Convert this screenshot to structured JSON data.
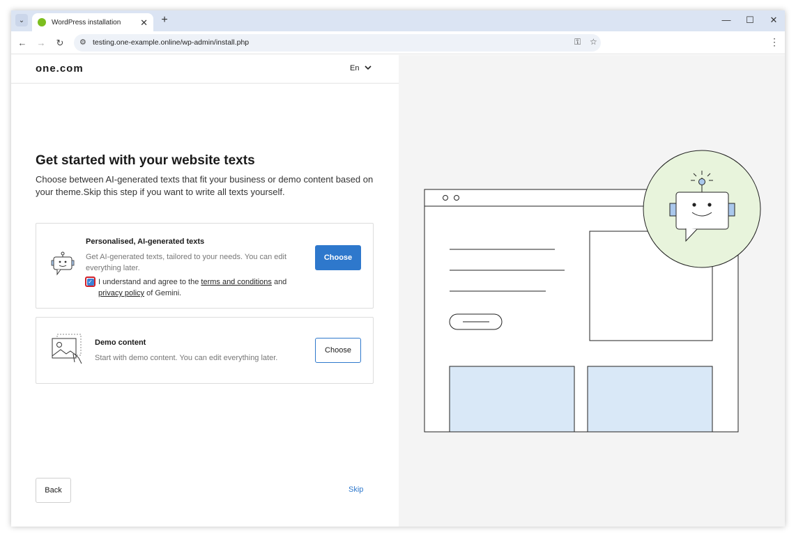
{
  "browser": {
    "tab_title": "WordPress installation",
    "url": "testing.one-example.online/wp-admin/install.php",
    "new_tab": "+",
    "tab_close": "✕",
    "minimize": "—",
    "maximize": "☐",
    "close": "✕"
  },
  "header": {
    "logo": "one.com",
    "language": "En"
  },
  "main": {
    "heading": "Get started with your website texts",
    "subtext": "Choose between AI-generated texts that fit your business or demo content based on your theme.Skip this step if you want to write all texts yourself."
  },
  "option_ai": {
    "title": "Personalised, AI-generated texts",
    "description": "Get AI-generated texts, tailored to your needs. You can edit everything later.",
    "agree_prefix": "I understand and agree to the ",
    "terms_link": "terms and conditions",
    "agree_middle": " and ",
    "privacy_link": "privacy policy",
    "agree_suffix": " of Gemini.",
    "checked": true,
    "button": "Choose"
  },
  "option_demo": {
    "title": "Demo content",
    "description": "Start with demo content. You can edit everything later.",
    "button": "Choose"
  },
  "footer": {
    "back": "Back",
    "skip": "Skip"
  },
  "colors": {
    "accent": "#2e78cc",
    "panel_bg": "#f4f4f4",
    "bot_circle": "#e8f4dc",
    "placeholder_block": "#d9e8f7"
  }
}
